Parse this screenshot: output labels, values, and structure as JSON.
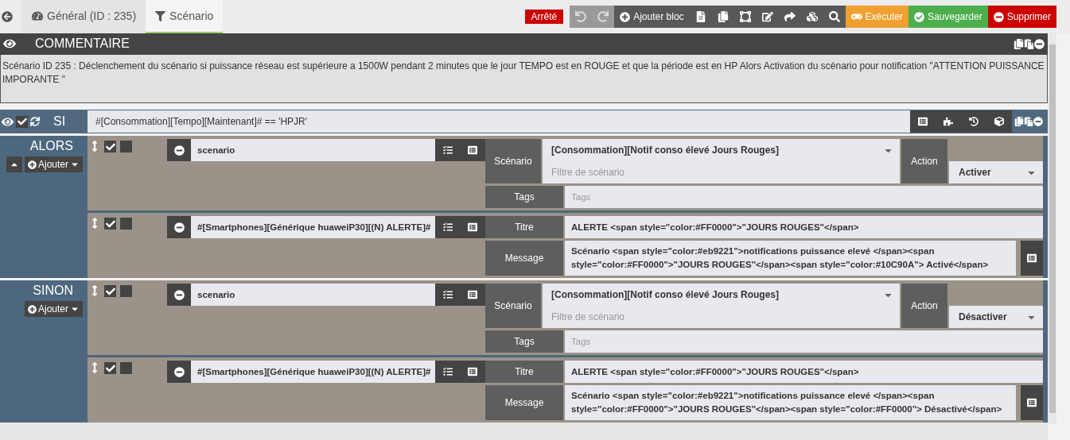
{
  "tabs": [
    {
      "label": "Général (ID : 235)",
      "selected": false
    },
    {
      "label": "Scénario",
      "selected": true
    }
  ],
  "status": "Arrêté",
  "toolbar": {
    "add_block": "Ajouter bloc",
    "execute": "Exécuter",
    "save": "Sauvegarder",
    "delete": "Supprimer"
  },
  "comment": {
    "title": "COMMENTAIRE",
    "text": "Scénario ID 235 : Déclenchement du scénario si puissance réseau est supérieure a 1500W pendant 2 minutes que le jour TEMPO est en ROUGE et que la période est en HP Alors  Activation du scénario pour notification \"ATTENTION PUISSANCE IMPORANTE \""
  },
  "condition": {
    "label": "SI",
    "expression": "#[Consommation][Tempo][Maintenant]# == 'HPJR'",
    "enabled": true
  },
  "branches": [
    {
      "label": "ALORS",
      "add": "Ajouter",
      "collapsible": true,
      "actions": [
        {
          "kind": "scenario",
          "enabled": true,
          "background": false,
          "command": "scenario",
          "scenario_label": "Scénario",
          "scenario": "[Consommation][Notif conso élevé Jours Rouges]",
          "filter_placeholder": "Filtre de scénario",
          "action_label": "Action",
          "action": "Activer",
          "tags_label": "Tags",
          "tags_placeholder": "Tags"
        },
        {
          "kind": "message",
          "enabled": true,
          "background": false,
          "command": "#[Smartphones][Générique huaweiP30][(N) ALERTE]#",
          "title_label": "Titre",
          "title": "ALERTE <span style=\"color:#FF0000\">\"JOURS ROUGES\"</span>",
          "message_label": "Message",
          "message": "Scénario <span style=\"color:#eb9221\">notifications puissance elevé </span><span style=\"color:#FF0000\">\"JOURS ROUGES\"</span><span style=\"color:#10C90A\"> Activé</span>"
        }
      ]
    },
    {
      "label": "SINON",
      "add": "Ajouter",
      "collapsible": false,
      "actions": [
        {
          "kind": "scenario",
          "enabled": true,
          "background": false,
          "command": "scenario",
          "scenario_label": "Scénario",
          "scenario": "[Consommation][Notif conso élevé Jours Rouges]",
          "filter_placeholder": "Filtre de scénario",
          "action_label": "Action",
          "action": "Désactiver",
          "tags_label": "Tags",
          "tags_placeholder": "Tags"
        },
        {
          "kind": "message",
          "enabled": true,
          "background": false,
          "command": "#[Smartphones][Générique huaweiP30][(N) ALERTE]#",
          "title_label": "Titre",
          "title": "ALERTE <span style=\"color:#FF0000\">\"JOURS ROUGES\"</span>",
          "message_label": "Message",
          "message": "Scénario <span style=\"color:#eb9221\">notifications puissance elevé </span><span style=\"color:#FF0000\">\"JOURS ROUGES\"</span><span style=\"color:#FF0000\"> Désactivé</span>"
        }
      ]
    }
  ]
}
